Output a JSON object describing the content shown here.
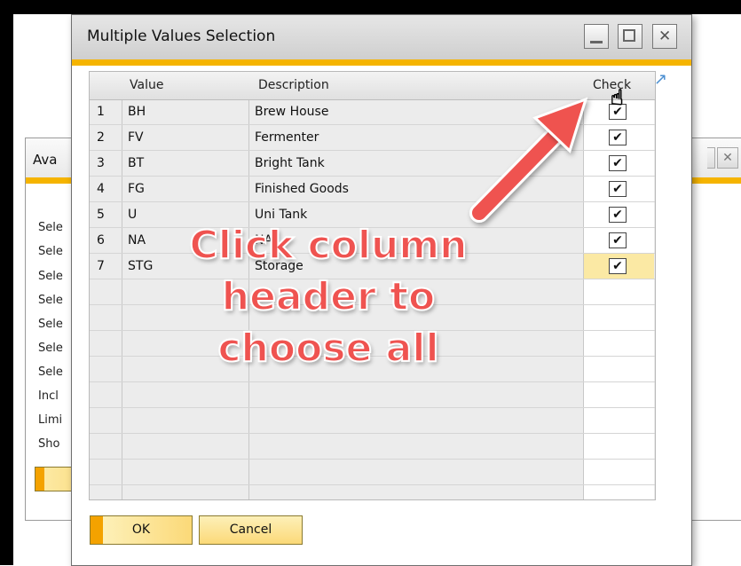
{
  "background_window": {
    "title": "Ava",
    "labels": [
      "Sele",
      "Sele",
      "Sele",
      "Sele",
      "Sele",
      "Sele",
      "Sele",
      "Incl",
      "Limi",
      "Sho"
    ]
  },
  "dialog": {
    "title": "Multiple Values Selection",
    "window_buttons": {
      "minimize": "_",
      "maximize": "□",
      "close": "✕"
    },
    "grid": {
      "headers": {
        "num": "",
        "value": "Value",
        "description": "Description",
        "check": "Check"
      },
      "rows": [
        {
          "num": "1",
          "value": "BH",
          "description": "Brew House",
          "checked": "✔"
        },
        {
          "num": "2",
          "value": "FV",
          "description": "Fermenter",
          "checked": "✔"
        },
        {
          "num": "3",
          "value": "BT",
          "description": "Bright Tank",
          "checked": "✔"
        },
        {
          "num": "4",
          "value": "FG",
          "description": "Finished Goods",
          "checked": "✔"
        },
        {
          "num": "5",
          "value": "U",
          "description": "Uni Tank",
          "checked": "✔"
        },
        {
          "num": "6",
          "value": "NA",
          "description": "NA",
          "checked": "✔"
        },
        {
          "num": "7",
          "value": "STG",
          "description": "Storage",
          "checked": "✔"
        }
      ],
      "expand_icon": "↗"
    },
    "buttons": {
      "ok": "OK",
      "cancel": "Cancel"
    }
  },
  "annotation": {
    "text_lines": [
      "Click column",
      "header to",
      "choose all"
    ],
    "color": "#ef5350"
  },
  "colors": {
    "accent": "#f5b400",
    "highlight_cell": "#fbe9a4"
  }
}
